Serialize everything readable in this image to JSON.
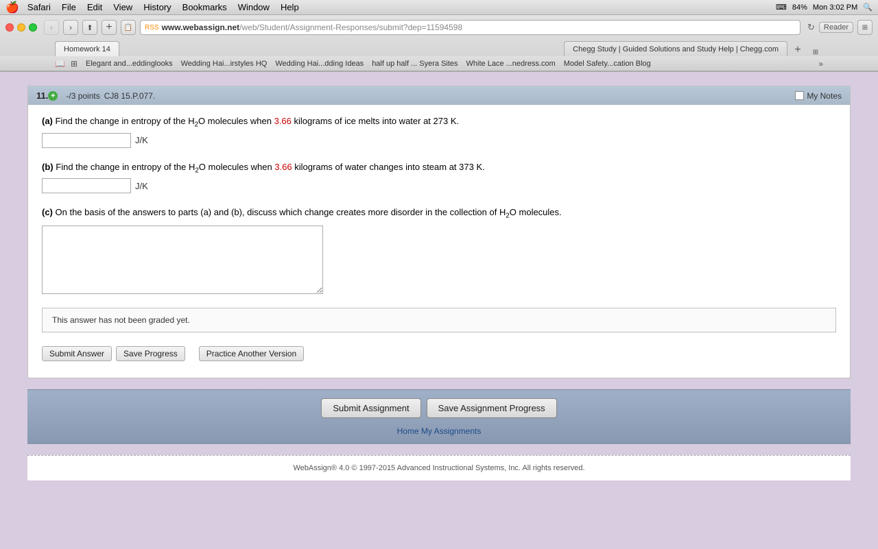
{
  "menubar": {
    "apple": "🍎",
    "items": [
      "Safari",
      "File",
      "Edit",
      "View",
      "History",
      "Bookmarks",
      "Window",
      "Help"
    ],
    "time": "Mon 3:02 PM",
    "battery": "84%"
  },
  "browser": {
    "title": "Homework 14",
    "url_base": "www.webassign.net",
    "url_path": "/web/Student/Assignment-Responses/submit?dep=11594598",
    "reload_label": "↻",
    "reader_label": "Reader"
  },
  "tabs": [
    {
      "label": "Homework 14",
      "active": true
    },
    {
      "label": "Chegg Study | Guided Solutions and Study Help | Chegg.com",
      "active": false
    }
  ],
  "bookmarks": [
    "Elegant and...eddinglooks",
    "Wedding Hai...irstyles HQ",
    "Wedding Hai...dding Ideas",
    "half up half ... Syera Sites",
    "White Lace ...nedress.com",
    "Model Safety...cation Blog"
  ],
  "question": {
    "number": "11.",
    "plus_sign": "+",
    "points": "-/3 points",
    "code": "CJ8 15.P.077.",
    "notes_label": "My Notes",
    "parts": {
      "a": {
        "label": "(a)",
        "text_before": " Find the change in entropy of the H",
        "sub": "2",
        "text_after": "O molecules when ",
        "value": "3.66",
        "text_end": " kilograms of ice melts into water at 273 K.",
        "unit": "J/K",
        "placeholder": ""
      },
      "b": {
        "label": "(b)",
        "text_before": " Find the change in entropy of the H",
        "sub": "2",
        "text_after": "O molecules when ",
        "value": "3.66",
        "text_end": " kilograms of water changes into steam at 373 K.",
        "unit": "J/K",
        "placeholder": ""
      },
      "c": {
        "label": "(c)",
        "text": " On the basis of the answers to parts (a) and (b), discuss which change creates more disorder in the collection of H",
        "sub": "2",
        "text_end": "O molecules.",
        "placeholder": ""
      }
    },
    "grading_note": "This answer has not been graded yet.",
    "buttons": {
      "submit": "Submit Answer",
      "save": "Save Progress",
      "practice": "Practice Another Version"
    }
  },
  "footer": {
    "submit_assignment": "Submit Assignment",
    "save_progress": "Save Assignment Progress",
    "home_link": "Home",
    "my_assignments_link": "My Assignments"
  },
  "copyright": {
    "text": "WebAssign® 4.0 © 1997-2015 Advanced Instructional Systems, Inc. All rights reserved."
  }
}
